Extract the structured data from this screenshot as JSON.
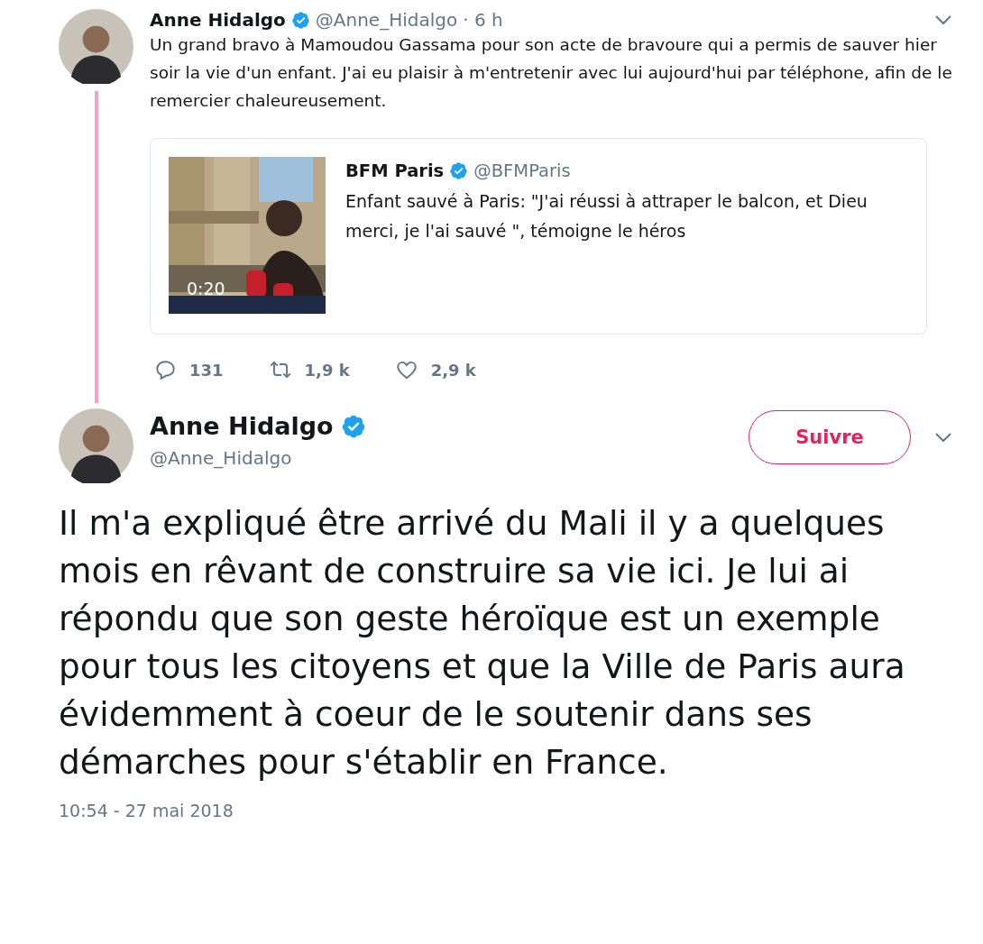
{
  "reply_tweet": {
    "author": {
      "name": "Anne Hidalgo",
      "handle": "@Anne_Hidalgo",
      "verified": true
    },
    "time": "· 6 h",
    "text": "Un grand bravo à Mamoudou Gassama pour son acte de bravoure qui a permis de sauver hier soir la vie d'un enfant. J'ai eu plaisir à m'entretenir avec lui aujourd'hui par téléphone, afin de le remercier chaleureusement.",
    "quoted": {
      "author": {
        "name": "BFM Paris",
        "handle": "@BFMParis",
        "verified": true
      },
      "text": "Enfant sauvé à Paris: \"J'ai réussi à attraper le balcon, et Dieu merci, je l'ai sauvé \", témoigne le héros",
      "media": {
        "kind": "picture",
        "duration": "0:20"
      }
    },
    "actions": [
      {
        "kind": "reply",
        "count": "131"
      },
      {
        "kind": "retweet",
        "count": "1,9 k"
      },
      {
        "kind": "like",
        "count": "2,9 k"
      }
    ]
  },
  "main_tweet": {
    "author": {
      "name": "Anne Hidalgo",
      "handle": "@Anne_Hidalgo",
      "verified": true
    },
    "follow_button": "Suivre",
    "text": "Il m'a expliqué être arrivé du Mali il y a quelques mois en rêvant de construire sa vie ici. Je lui ai répondu que son geste héroïque est un exemple pour tous les citoyens et que la Ville de Paris aura évidemment à coeur de le soutenir dans ses démarches pour s'établir en France.",
    "timestamp": "10:54 - 27 mai 2018"
  }
}
